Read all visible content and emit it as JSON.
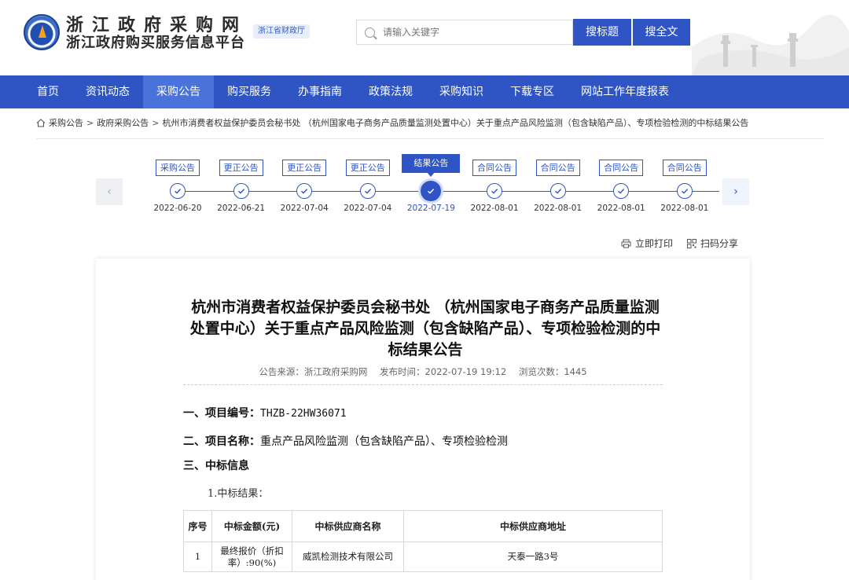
{
  "header": {
    "title_line1": "浙江政府采购网",
    "title_line2": "浙江政府购买服务信息平台",
    "gov_tag": "浙江省财政厅",
    "search_placeholder": "请输入关键字",
    "btn_search_title": "搜标题",
    "btn_search_full": "搜全文"
  },
  "nav": [
    "首页",
    "资讯动态",
    "采购公告",
    "购买服务",
    "办事指南",
    "政策法规",
    "采购知识",
    "下载专区",
    "网站工作年度报表"
  ],
  "nav_active_index": 2,
  "breadcrumb": {
    "items": [
      "采购公告",
      "政府采购公告",
      "杭州市消费者权益保护委员会秘书处 （杭州国家电子商务产品质量监测处置中心）关于重点产品风险监测（包含缺陷产品）、专项检验检测的中标结果公告"
    ],
    "separator": ">"
  },
  "timeline": [
    {
      "label": "采购公告",
      "date": "2022-06-20"
    },
    {
      "label": "更正公告",
      "date": "2022-06-21"
    },
    {
      "label": "更正公告",
      "date": "2022-07-04"
    },
    {
      "label": "更正公告",
      "date": "2022-07-04"
    },
    {
      "label": "结果公告",
      "date": "2022-07-19"
    },
    {
      "label": "合同公告",
      "date": "2022-08-01"
    },
    {
      "label": "合同公告",
      "date": "2022-08-01"
    },
    {
      "label": "合同公告",
      "date": "2022-08-01"
    },
    {
      "label": "合同公告",
      "date": "2022-08-01"
    }
  ],
  "timeline_active_index": 4,
  "actions": {
    "print": "立即打印",
    "share": "扫码分享"
  },
  "document": {
    "title": "杭州市消费者权益保护委员会秘书处 （杭州国家电子商务产品质量监测处置中心）关于重点产品风险监测（包含缺陷产品）、专项检验检测的中标结果公告",
    "source_label": "公告来源：浙江政府采购网",
    "publish_label": "发布时间：2022-07-19 19:12",
    "views_label": "浏览次数：1445",
    "sec1_label": "一、项目编号：",
    "sec1_value": "THZB-22HW36071",
    "sec2_label": "二、项目名称：",
    "sec2_value": "重点产品风险监测（包含缺陷产品）、专项检验检测",
    "sec3_label": "三、中标信息",
    "sub_heading": "1.中标结果：",
    "table": {
      "headers": [
        "序号",
        "中标金额(元)",
        "中标供应商名称",
        "中标供应商地址"
      ],
      "rows": [
        [
          "1",
          "最终报价（折扣率）:90(%)",
          "威凯检测技术有限公司",
          "天泰一路3号"
        ]
      ]
    }
  },
  "colors": {
    "primary": "#2f54c4",
    "nav_active": "#4a72db"
  }
}
